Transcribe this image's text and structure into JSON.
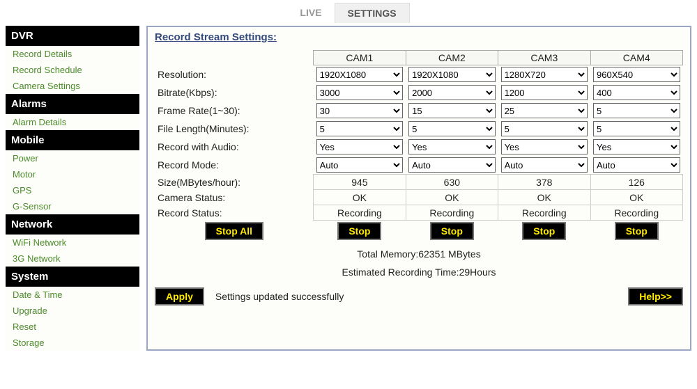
{
  "tabs": {
    "live": "LIVE",
    "settings": "SETTINGS"
  },
  "sidebar": {
    "dvr": {
      "header": "DVR",
      "items": [
        "Record Details",
        "Record Schedule",
        "Camera Settings"
      ]
    },
    "alarms": {
      "header": "Alarms",
      "items": [
        "Alarm Details"
      ]
    },
    "mobile": {
      "header": "Mobile",
      "items": [
        "Power",
        "Motor",
        "GPS",
        "G-Sensor"
      ]
    },
    "network": {
      "header": "Network",
      "items": [
        "WiFi Network",
        "3G Network"
      ]
    },
    "system": {
      "header": "System",
      "items": [
        "Date & Time",
        "Upgrade",
        "Reset",
        "Storage"
      ]
    }
  },
  "section_title": "Record Stream Settings:",
  "col_headers": [
    "CAM1",
    "CAM2",
    "CAM3",
    "CAM4"
  ],
  "rows": {
    "resolution": {
      "label": "Resolution:",
      "values": [
        "1920X1080",
        "1920X1080",
        "1280X720",
        "960X540"
      ]
    },
    "bitrate": {
      "label": "Bitrate(Kbps):",
      "values": [
        "3000",
        "2000",
        "1200",
        "400"
      ]
    },
    "framerate": {
      "label": "Frame Rate(1~30):",
      "values": [
        "30",
        "15",
        "25",
        "5"
      ]
    },
    "filelen": {
      "label": "File Length(Minutes):",
      "values": [
        "5",
        "5",
        "5",
        "5"
      ]
    },
    "audio": {
      "label": "Record with Audio:",
      "values": [
        "Yes",
        "Yes",
        "Yes",
        "Yes"
      ]
    },
    "mode": {
      "label": "Record Mode:",
      "values": [
        "Auto",
        "Auto",
        "Auto",
        "Auto"
      ]
    },
    "size": {
      "label": "Size(MBytes/hour):",
      "values": [
        "945",
        "630",
        "378",
        "126"
      ]
    },
    "camstatus": {
      "label": "Camera Status:",
      "values": [
        "OK",
        "OK",
        "OK",
        "OK"
      ]
    },
    "recstatus": {
      "label": "Record Status:",
      "values": [
        "Recording",
        "Recording",
        "Recording",
        "Recording"
      ]
    }
  },
  "buttons": {
    "stop_all": "Stop All",
    "stop": "Stop",
    "apply": "Apply",
    "help": "Help>>"
  },
  "memory": {
    "total": "Total Memory:62351 MBytes",
    "est": "Estimated Recording Time:29Hours"
  },
  "status_msg": "Settings updated successfully"
}
